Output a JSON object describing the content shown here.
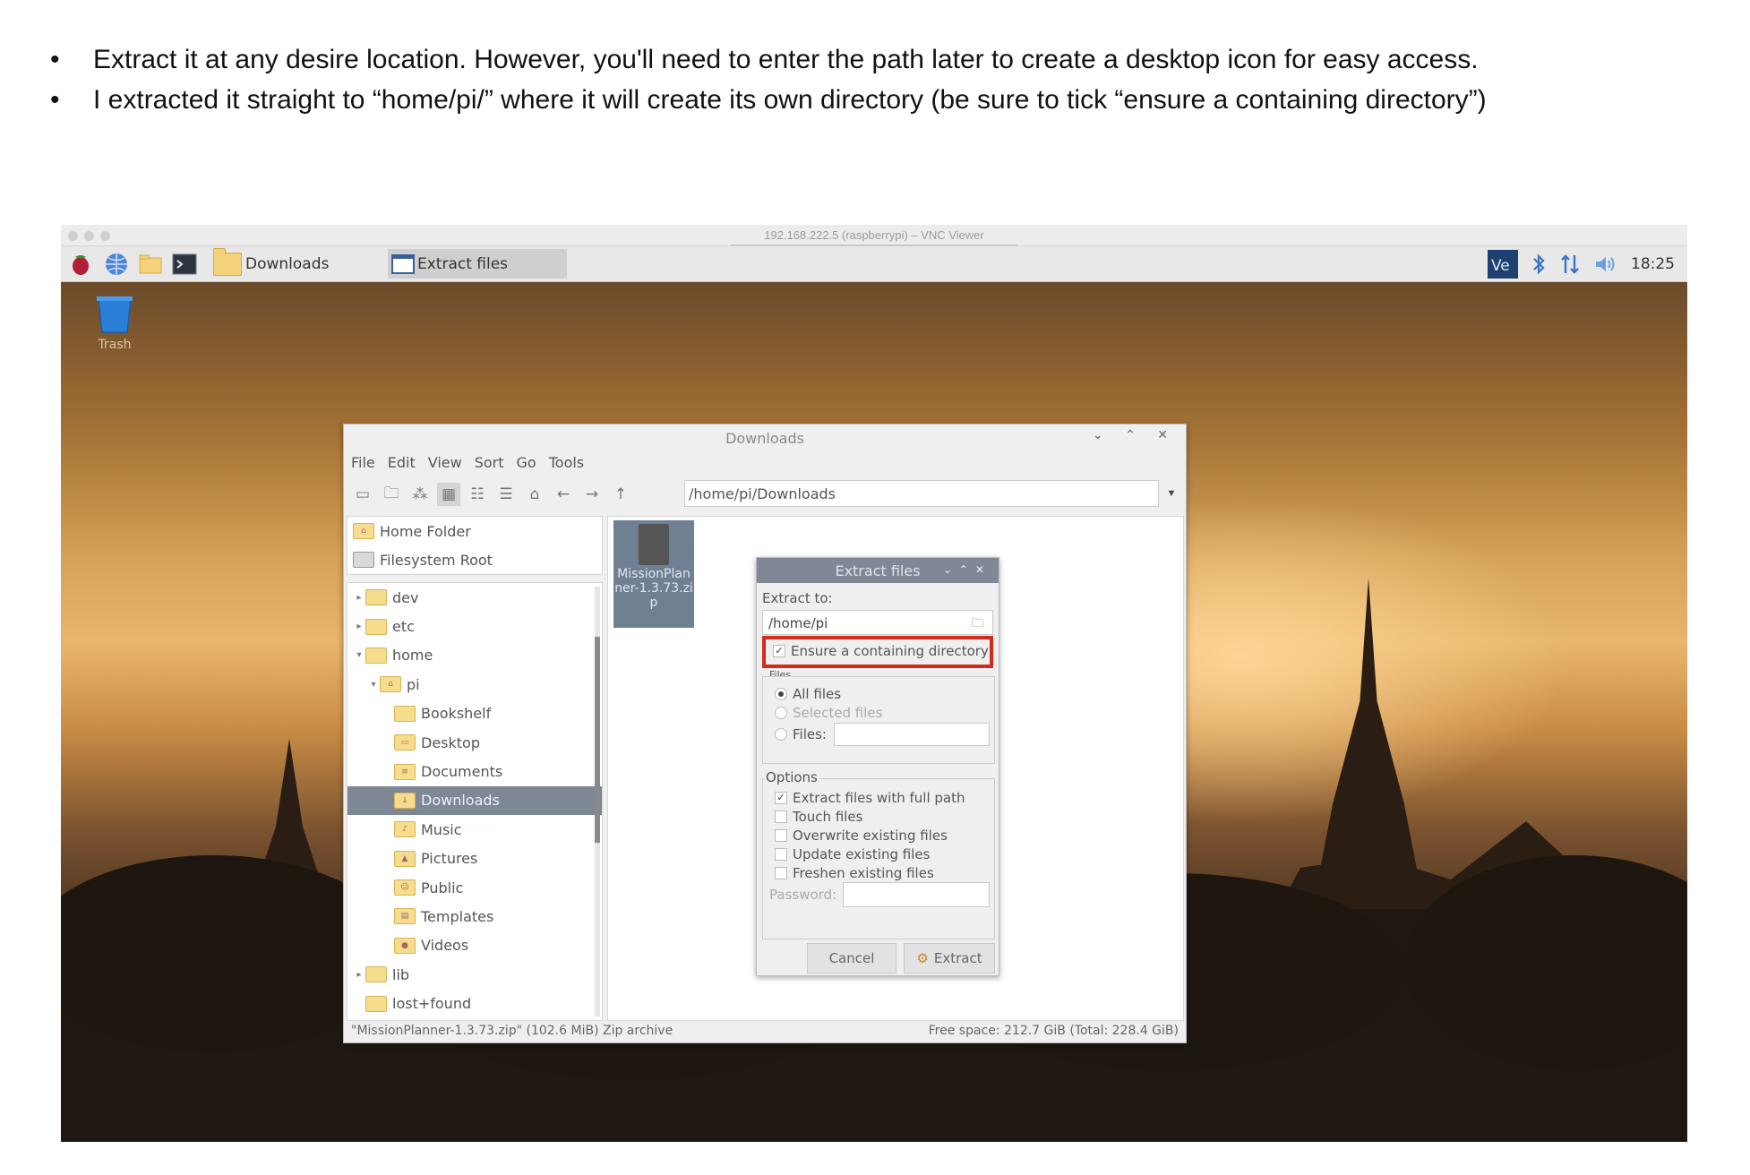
{
  "instructions": [
    "Extract it at any desire location. However, you'll need to enter the path later to create a desktop icon for easy  access.",
    "I extracted it straight to “home/pi/” where it will create its own directory (be sure to tick “ensure a containing directory”)"
  ],
  "vnc": {
    "title": "192.168.222.5 (raspberrypi) – VNC Viewer"
  },
  "taskbar": {
    "downloads_label": "Downloads",
    "extract_label": "Extract files",
    "clock": "18:25",
    "tray_icons": [
      "vnc-icon",
      "bluetooth-icon",
      "network-icon",
      "volume-icon"
    ]
  },
  "desktop": {
    "trash_label": "Trash"
  },
  "file_manager": {
    "title": "Downloads",
    "menu": [
      "File",
      "Edit",
      "View",
      "Sort",
      "Go",
      "Tools"
    ],
    "path": "/home/pi/Downloads",
    "places": [
      "Home Folder",
      "Filesystem Root"
    ],
    "tree": [
      {
        "label": "dev",
        "depth": 0,
        "arrow": "▸"
      },
      {
        "label": "etc",
        "depth": 0,
        "arrow": "▸"
      },
      {
        "label": "home",
        "depth": 0,
        "arrow": "▾"
      },
      {
        "label": "pi",
        "depth": 1,
        "arrow": "▾"
      },
      {
        "label": "Bookshelf",
        "depth": 2,
        "arrow": ""
      },
      {
        "label": "Desktop",
        "depth": 2,
        "arrow": ""
      },
      {
        "label": "Documents",
        "depth": 2,
        "arrow": ""
      },
      {
        "label": "Downloads",
        "depth": 2,
        "arrow": "",
        "selected": true
      },
      {
        "label": "Music",
        "depth": 2,
        "arrow": ""
      },
      {
        "label": "Pictures",
        "depth": 2,
        "arrow": ""
      },
      {
        "label": "Public",
        "depth": 2,
        "arrow": ""
      },
      {
        "label": "Templates",
        "depth": 2,
        "arrow": ""
      },
      {
        "label": "Videos",
        "depth": 2,
        "arrow": ""
      },
      {
        "label": "lib",
        "depth": 0,
        "arrow": "▸"
      },
      {
        "label": "lost+found",
        "depth": 0,
        "arrow": ""
      }
    ],
    "file_item": "MissionPlan ner-1.3.73.zi p",
    "status_left": "\"MissionPlanner-1.3.73.zip\" (102.6 MiB) Zip archive",
    "status_right": "Free space: 212.7 GiB (Total: 228.4 GiB)"
  },
  "extract_dialog": {
    "title": "Extract files",
    "extract_to_label": "Extract to:",
    "extract_to_value": "/home/pi",
    "ensure_dir_label": "Ensure a containing directory",
    "files_group_label": "Files",
    "all_files": "All files",
    "selected_files": "Selected files",
    "files_field_label": "Files:",
    "options_label": "Options",
    "options": [
      {
        "label": "Extract files with full path",
        "checked": true
      },
      {
        "label": "Touch files",
        "checked": false
      },
      {
        "label": "Overwrite existing files",
        "checked": false
      },
      {
        "label": "Update existing files",
        "checked": false
      },
      {
        "label": "Freshen existing files",
        "checked": false
      }
    ],
    "password_label": "Password:",
    "cancel_label": "Cancel",
    "extract_label": "Extract"
  }
}
